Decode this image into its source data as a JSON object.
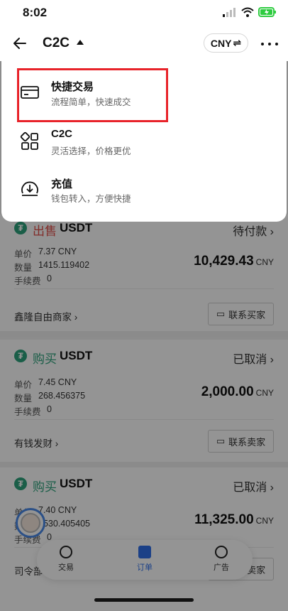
{
  "status_bar": {
    "time": "8:02"
  },
  "header": {
    "title": "C2C",
    "currency": "CNY",
    "currency_swap_symbol": "⇌"
  },
  "menu": {
    "items": [
      {
        "title": "快捷交易",
        "subtitle": "流程简单，快速成交",
        "icon": "card-icon"
      },
      {
        "title": "C2C",
        "subtitle": "灵活选择，价格更优",
        "icon": "grid-icon"
      },
      {
        "title": "充值",
        "subtitle": "钱包转入，方便快捷",
        "icon": "deposit-icon"
      }
    ]
  },
  "labels": {
    "unit_price": "单价",
    "quantity": "数量",
    "fee": "手续费",
    "coin_symbol": "₮"
  },
  "orders": [
    {
      "side": "出售",
      "asset": "USDT",
      "status": "待付款",
      "price": "7.37 CNY",
      "quantity": "1415.119402",
      "fee": "0",
      "amount": "10,429.43",
      "amount_unit": "CNY",
      "merchant": "鑫隆自由商家",
      "contact": "联系买家"
    },
    {
      "side": "购买",
      "asset": "USDT",
      "status": "已取消",
      "price": "7.45 CNY",
      "quantity": "268.456375",
      "fee": "0",
      "amount": "2,000.00",
      "amount_unit": "CNY",
      "merchant": "有钱发财",
      "contact": "联系卖家"
    },
    {
      "side": "购买",
      "asset": "USDT",
      "status": "已取消",
      "price": "7.40 CNY",
      "quantity": "1530.405405",
      "fee": "0",
      "amount": "11,325.00",
      "amount_unit": "CNY",
      "merchant": "司令部",
      "contact": "联系卖家"
    }
  ],
  "tabbar": {
    "items": [
      {
        "label": "交易"
      },
      {
        "label": "订单"
      },
      {
        "label": "广告"
      }
    ],
    "active": "订单"
  },
  "colors": {
    "buy": "#2ea27c",
    "sell": "#e0504a",
    "accent": "#2f6fe8",
    "highlight_box": "#e8232a"
  }
}
